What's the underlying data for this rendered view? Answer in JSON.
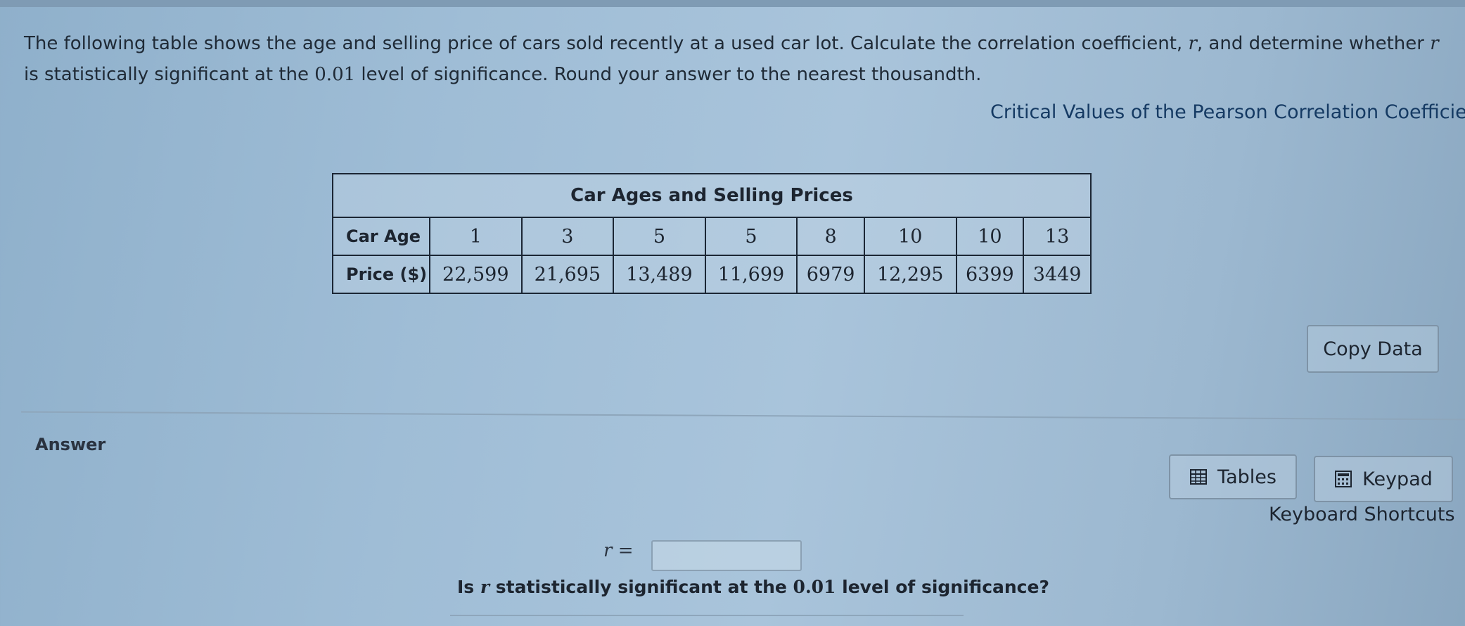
{
  "question": {
    "part1": "The following table shows the age and selling price of cars sold recently at a used car lot. Calculate the correlation coefficient, ",
    "var_r1": "r",
    "part2": ", and determine whether ",
    "var_r2": "r",
    "part3": " is statistically significant at the ",
    "level": "0.01",
    "part4": " level of significance. Round your answer to the nearest thousandth."
  },
  "critical_values_link": "Critical Values of the Pearson Correlation Coefficient",
  "table": {
    "caption": "Car Ages and Selling Prices",
    "row1_header": "Car Age",
    "row2_header": "Price ($)",
    "ages": [
      "1",
      "3",
      "5",
      "5",
      "8",
      "10",
      "10",
      "13"
    ],
    "prices": [
      "22,599",
      "21,695",
      "13,489",
      "11,699",
      "6979",
      "12,295",
      "6399",
      "3449"
    ]
  },
  "copy_data_label": "Copy Data",
  "answer": {
    "label": "Answer",
    "tables_label": "Tables",
    "keypad_label": "Keypad",
    "shortcuts_label": "Keyboard Shortcuts",
    "r_var": "r",
    "r_equals": "=",
    "r_value": "",
    "sig_pre": "Is ",
    "sig_var": "r",
    "sig_mid": " statistically significant at the ",
    "sig_level": "0.01",
    "sig_post": " level of significance?"
  },
  "icons": {
    "tables": "table-grid-icon",
    "keypad": "calculator-keypad-icon"
  }
}
